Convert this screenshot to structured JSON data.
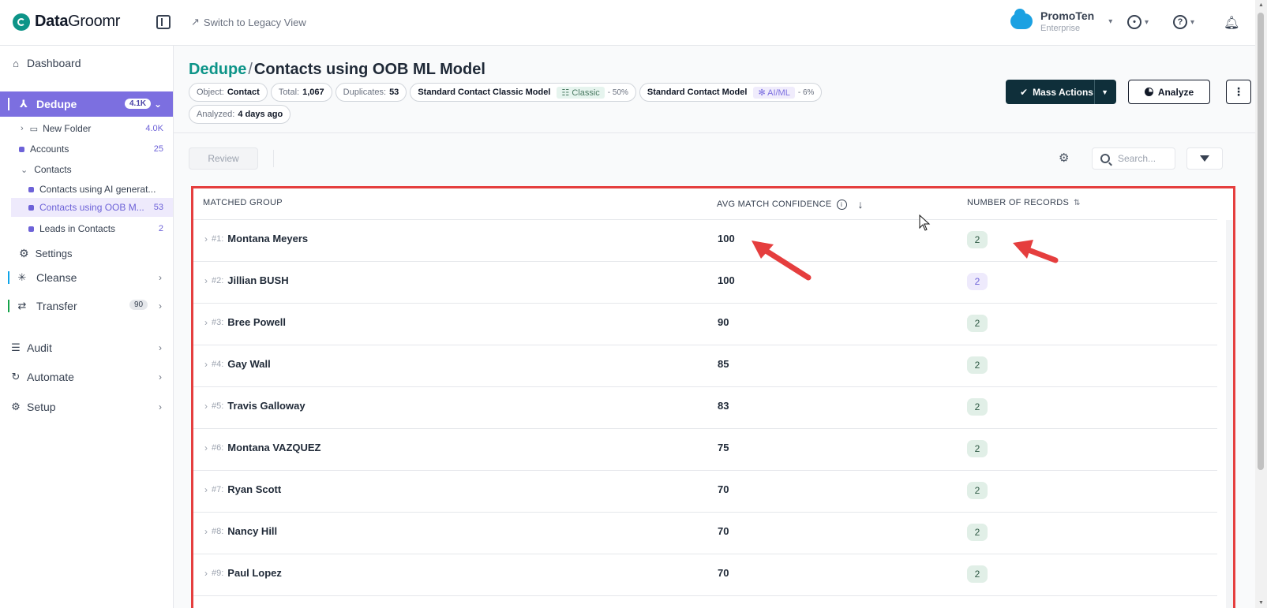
{
  "app": {
    "logo_bold": "Data",
    "logo_thin": "Groomr",
    "legacy_link": "Switch to Legacy View",
    "org_name": "PromoTen",
    "org_edition": "Enterprise"
  },
  "sidebar": {
    "dashboard": "Dashboard",
    "dedupe": "Dedupe",
    "dedupe_count": "4.1K",
    "new_folder": "New Folder",
    "new_folder_count": "4.0K",
    "accounts": "Accounts",
    "accounts_count": "25",
    "contacts": "Contacts",
    "contacts_ai": "Contacts using AI generat...",
    "contacts_oob": "Contacts using OOB M...",
    "contacts_oob_count": "53",
    "leads": "Leads in Contacts",
    "leads_count": "2",
    "settings": "Settings",
    "cleanse": "Cleanse",
    "transfer": "Transfer",
    "transfer_count": "90",
    "audit": "Audit",
    "automate": "Automate",
    "setup": "Setup"
  },
  "header": {
    "crumb_parent": "Dedupe",
    "crumb_sep": "/",
    "title": "Contacts using OOB ML Model",
    "object_k": "Object:",
    "object_v": "Contact",
    "total_k": "Total:",
    "total_v": "1,067",
    "dup_k": "Duplicates:",
    "dup_v": "53",
    "classic_model": "Standard Contact Classic Model",
    "classic_tag": "Classic",
    "classic_pct": "- 50%",
    "ai_model": "Standard Contact Model",
    "ai_tag": "AI/ML",
    "ai_pct": "- 6%",
    "analyzed_k": "Analyzed:",
    "analyzed_v": "4 days ago",
    "mass_actions": "Mass Actions",
    "analyze": "Analyze"
  },
  "toolbar": {
    "review": "Review",
    "search_placeholder": "Search..."
  },
  "table": {
    "col_group": "MATCHED GROUP",
    "col_conf": "AVG MATCH CONFIDENCE",
    "col_records": "NUMBER OF RECORDS",
    "rows": [
      {
        "num": "#1:",
        "name": "Montana Meyers",
        "conf": "100",
        "records": "2",
        "badge": "green"
      },
      {
        "num": "#2:",
        "name": "Jillian BUSH",
        "conf": "100",
        "records": "2",
        "badge": "purple"
      },
      {
        "num": "#3:",
        "name": "Bree Powell",
        "conf": "90",
        "records": "2",
        "badge": "green"
      },
      {
        "num": "#4:",
        "name": "Gay Wall",
        "conf": "85",
        "records": "2",
        "badge": "green"
      },
      {
        "num": "#5:",
        "name": "Travis Galloway",
        "conf": "83",
        "records": "2",
        "badge": "green"
      },
      {
        "num": "#6:",
        "name": "Montana VAZQUEZ",
        "conf": "75",
        "records": "2",
        "badge": "green"
      },
      {
        "num": "#7:",
        "name": "Ryan Scott",
        "conf": "70",
        "records": "2",
        "badge": "green"
      },
      {
        "num": "#8:",
        "name": "Nancy Hill",
        "conf": "70",
        "records": "2",
        "badge": "green"
      },
      {
        "num": "#9:",
        "name": "Paul Lopez",
        "conf": "70",
        "records": "2",
        "badge": "green"
      }
    ]
  },
  "colors": {
    "brand": "#0d9488",
    "active_nav": "#7c6fe0",
    "highlight": "#e53e3e",
    "primary_button": "#0f2f3a"
  }
}
